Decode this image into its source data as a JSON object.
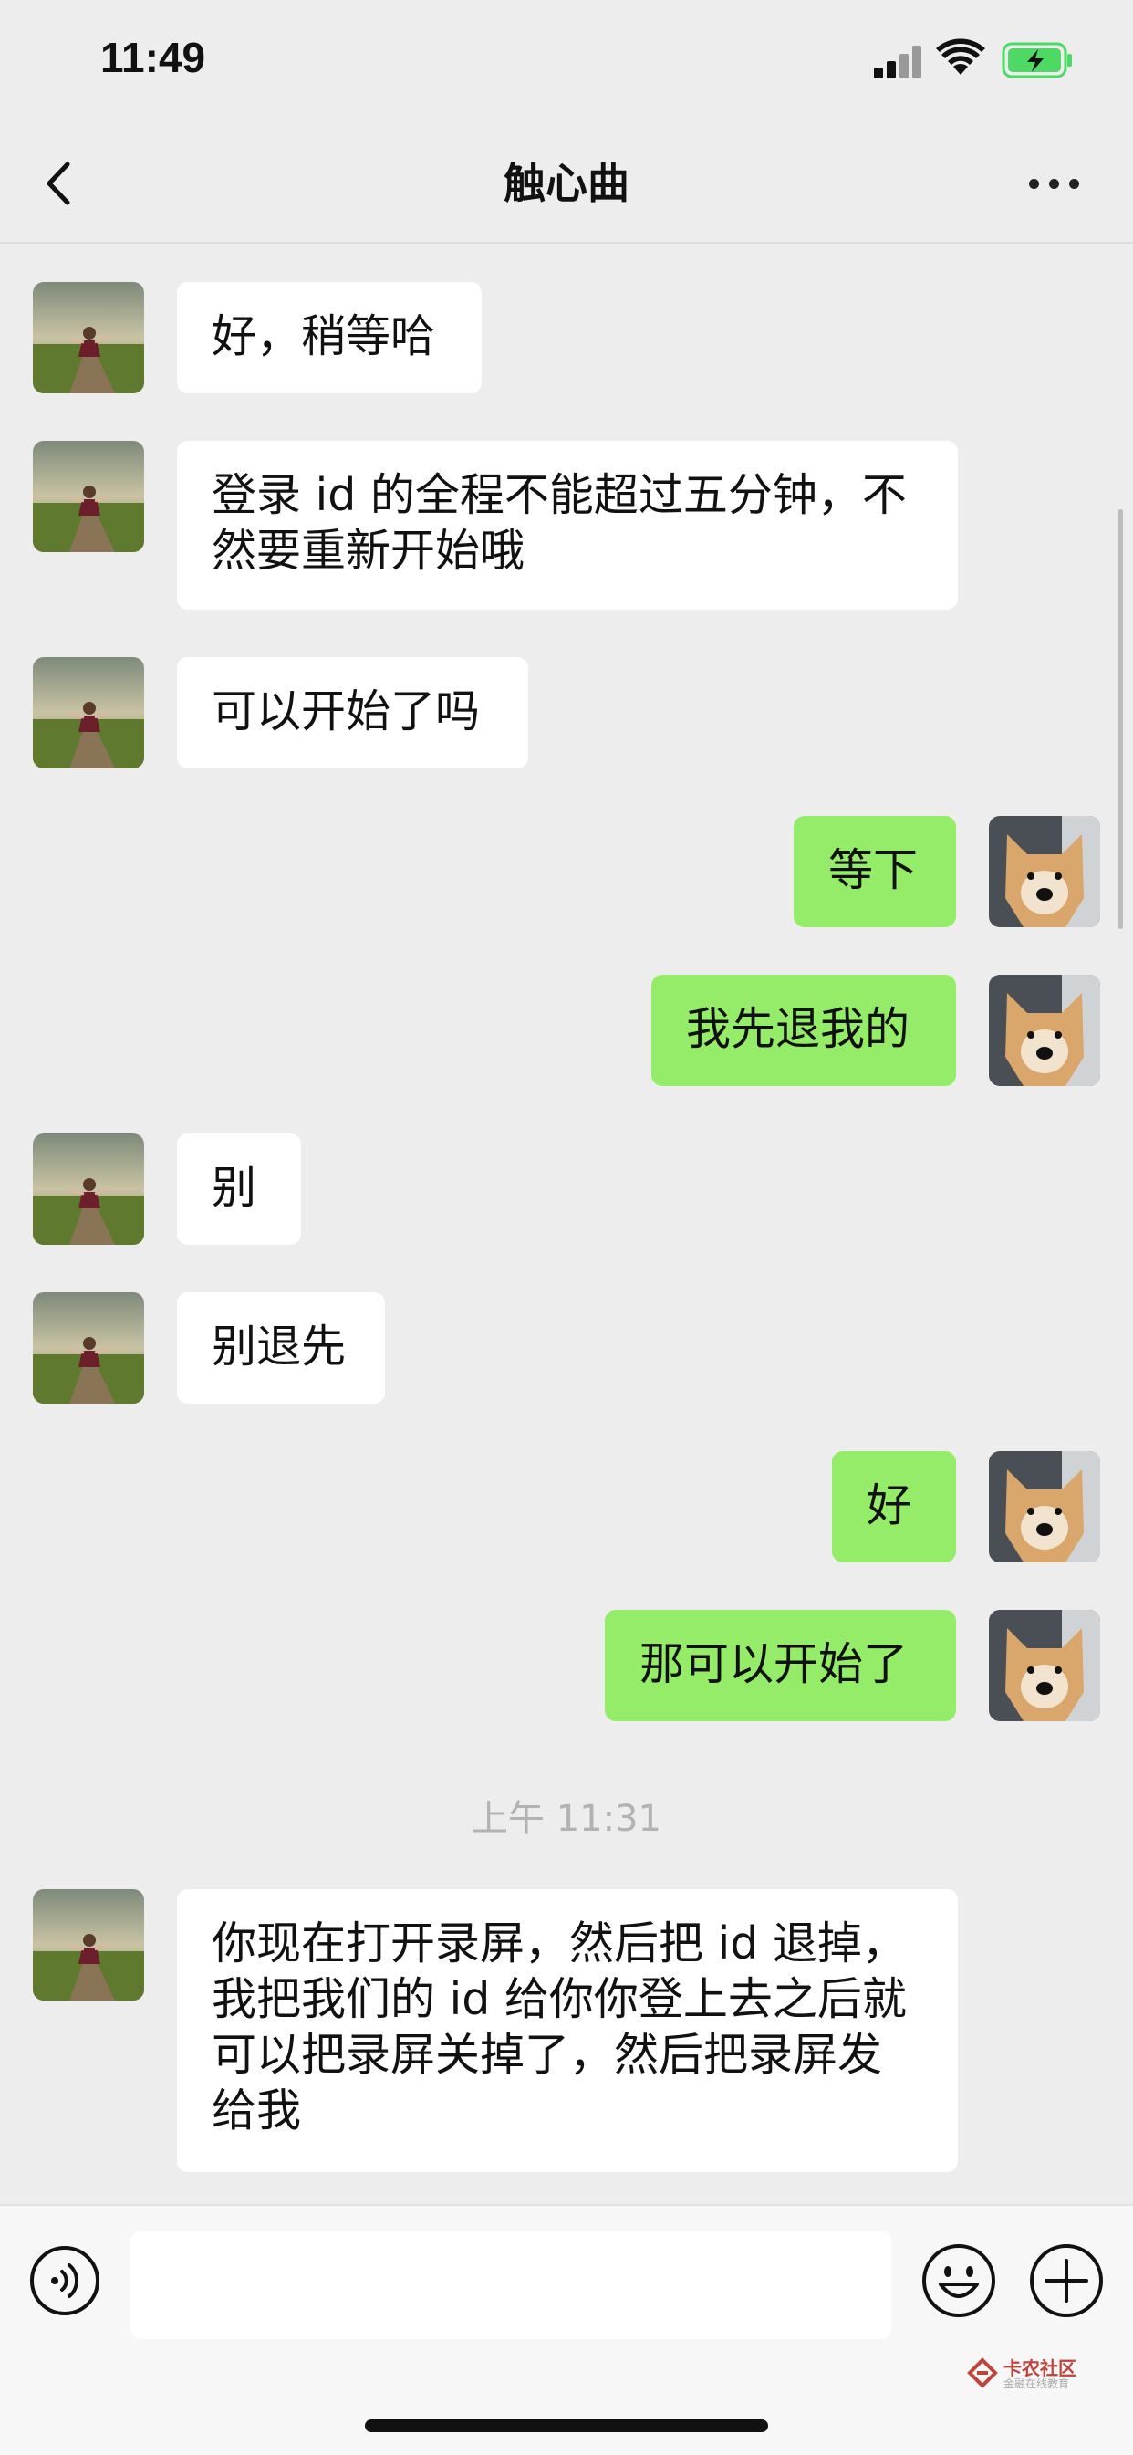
{
  "status_bar": {
    "time": "11:49"
  },
  "header": {
    "title": "触心曲"
  },
  "messages": [
    {
      "side": "in",
      "text": "好，稍等哈"
    },
    {
      "side": "in",
      "text": "登录 id 的全程不能超过五分钟，不\n然要重新开始哦"
    },
    {
      "side": "in",
      "text": "可以开始了吗"
    },
    {
      "side": "out",
      "text": "等下"
    },
    {
      "side": "out",
      "text": "我先退我的"
    },
    {
      "side": "in",
      "text": "别"
    },
    {
      "side": "in",
      "text": "别退先"
    },
    {
      "side": "out",
      "text": "好"
    },
    {
      "side": "out",
      "text": "那可以开始了"
    },
    {
      "side": "in",
      "text": "你现在打开录屏，然后把 id 退掉，\n我把我们的 id 给你你登上去之后就\n可以把录屏关掉了，然后把录屏发\n给我"
    }
  ],
  "timestamp": "上午 11:31",
  "watermark": {
    "name": "卡农社区",
    "tagline": "金融在线教育"
  },
  "colors": {
    "background": "#ededed",
    "outgoing_bubble": "#95ec69",
    "incoming_bubble": "#ffffff",
    "battery_fill": "#4cd964"
  },
  "icons": {
    "back": "chevron-left-icon",
    "more": "ellipsis-icon",
    "voice": "voice-icon",
    "emoji": "emoji-icon",
    "plus": "plus-icon"
  }
}
